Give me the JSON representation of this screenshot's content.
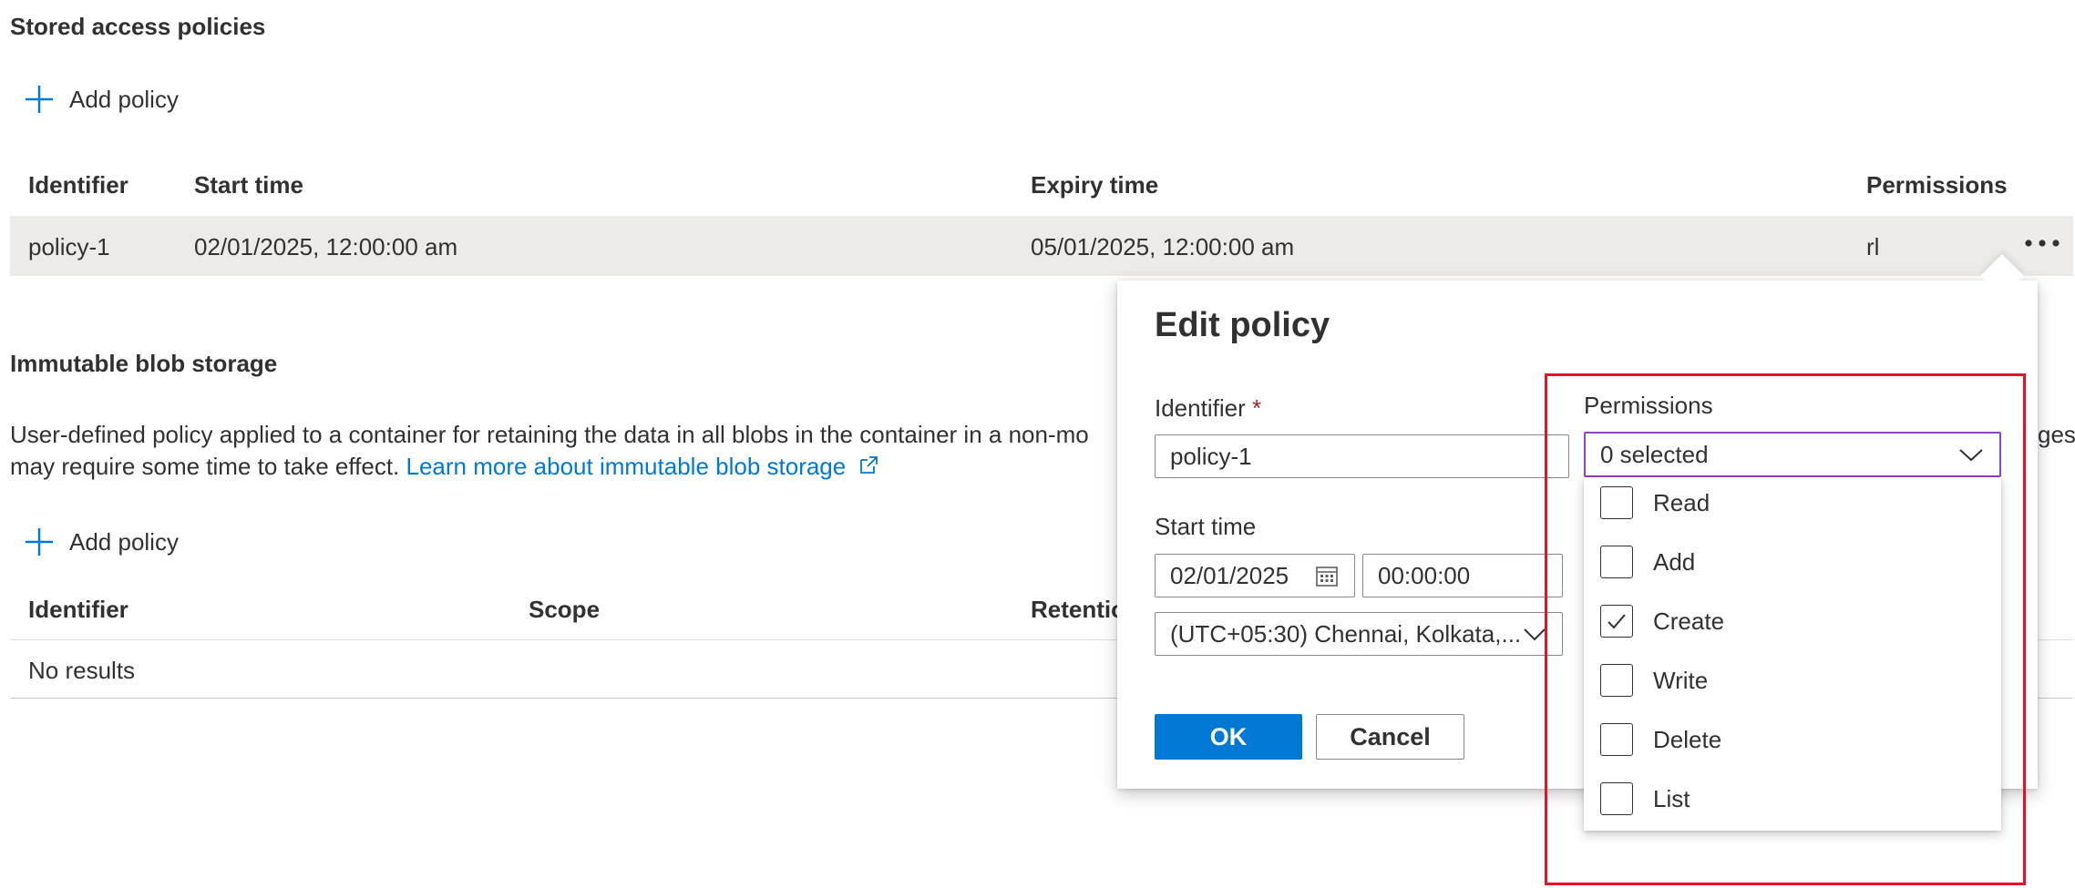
{
  "stored": {
    "title": "Stored access policies",
    "add_label": "Add policy",
    "headers": {
      "identifier": "Identifier",
      "start": "Start time",
      "expiry": "Expiry time",
      "permissions": "Permissions"
    },
    "row": {
      "identifier": "policy-1",
      "start": "02/01/2025, 12:00:00 am",
      "expiry": "05/01/2025, 12:00:00 am",
      "permissions": "rl"
    },
    "more_glyph": "•••"
  },
  "immutable": {
    "title": "Immutable blob storage",
    "desc_line1": "User-defined policy applied to a container for retaining the data in all blobs in the container in a non-mo",
    "desc_tail": "ges",
    "desc_line2": "may require some time to take effect.",
    "learn_more": "Learn more about immutable blob storage",
    "add_label": "Add policy",
    "headers": {
      "identifier": "Identifier",
      "scope": "Scope",
      "retention": "Retentio"
    },
    "empty": "No results"
  },
  "dialog": {
    "title": "Edit policy",
    "identifier_label": "Identifier",
    "required_mark": "*",
    "identifier_value": "policy-1",
    "start_label": "Start time",
    "start_date": "02/01/2025",
    "start_time": "00:00:00",
    "timezone": "(UTC+05:30) Chennai, Kolkata,...",
    "ok": "OK",
    "cancel": "Cancel",
    "permissions_label": "Permissions",
    "permissions_value": "0 selected",
    "options": [
      {
        "label": "Read",
        "checked": false
      },
      {
        "label": "Add",
        "checked": false
      },
      {
        "label": "Create",
        "checked": true
      },
      {
        "label": "Write",
        "checked": false
      },
      {
        "label": "Delete",
        "checked": false
      },
      {
        "label": "List",
        "checked": false
      }
    ]
  },
  "colors": {
    "accent": "#0078d4",
    "highlight": "#e81123",
    "row_bg": "#edebe9"
  }
}
